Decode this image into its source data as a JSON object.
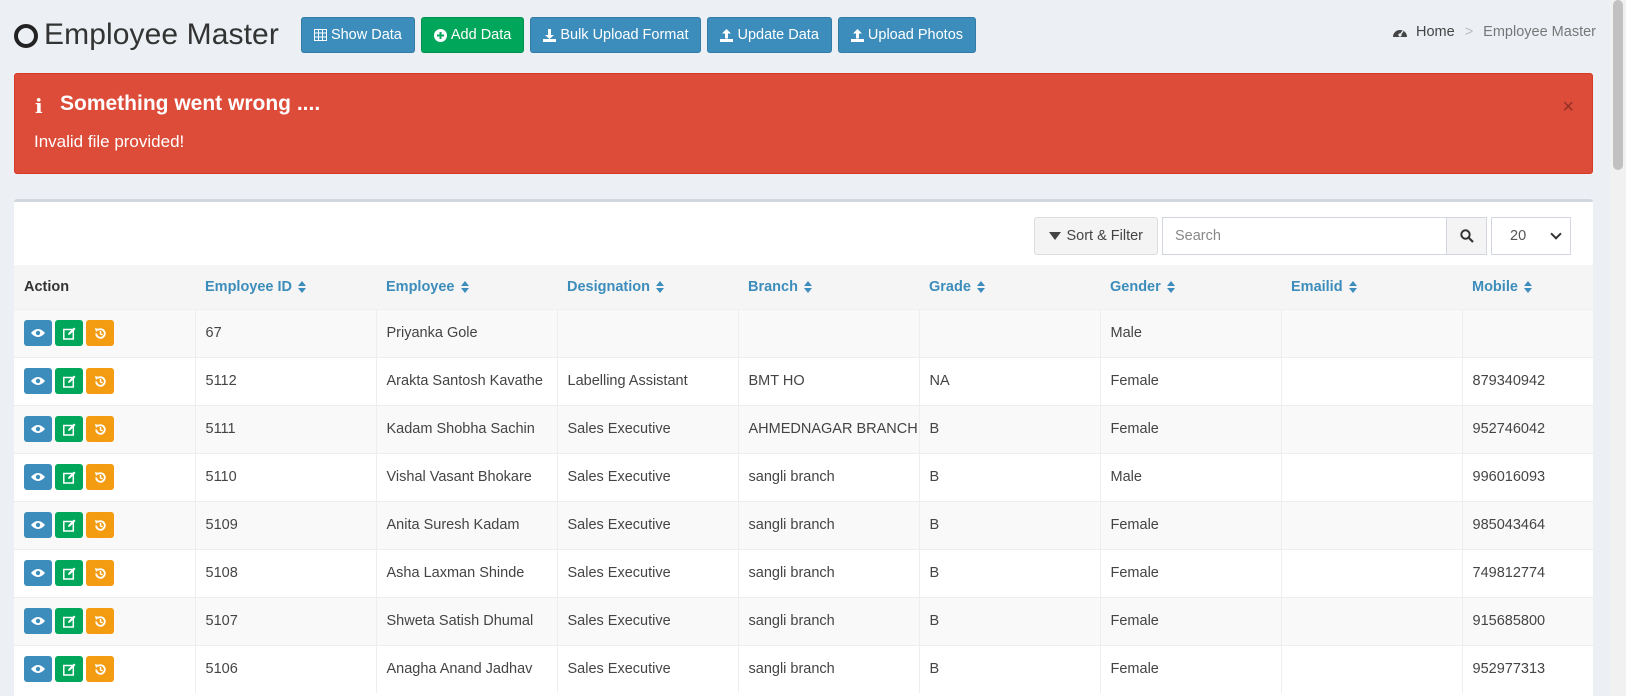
{
  "header": {
    "title": "Employee Master",
    "buttons": {
      "show_data": "Show Data",
      "add_data": "Add Data",
      "bulk_upload": "Bulk Upload Format",
      "update_data": "Update Data",
      "upload_photos": "Upload Photos"
    }
  },
  "breadcrumb": {
    "home": "Home",
    "separator": ">",
    "current": "Employee Master"
  },
  "alert": {
    "title": "Something went wrong ....",
    "message": "Invalid file provided!",
    "close": "×",
    "color": "#dd4b39"
  },
  "toolbar": {
    "sort_filter": "Sort & Filter",
    "search_placeholder": "Search",
    "page_size": "20"
  },
  "table": {
    "columns": {
      "action": "Action",
      "employee_id": "Employee ID",
      "employee": "Employee",
      "designation": "Designation",
      "branch": "Branch",
      "grade": "Grade",
      "gender": "Gender",
      "emailid": "Emailid",
      "mobile": "Mobile"
    },
    "rows": [
      {
        "id": "67",
        "name": "Priyanka Gole",
        "designation": "",
        "branch": "",
        "grade": "",
        "gender": "Male",
        "email": "",
        "mobile": ""
      },
      {
        "id": "5112",
        "name": "Arakta Santosh Kavathe",
        "designation": "Labelling Assistant",
        "branch": "BMT HO",
        "grade": "NA",
        "gender": "Female",
        "email": "",
        "mobile": "879340942"
      },
      {
        "id": "5111",
        "name": "Kadam Shobha Sachin",
        "designation": "Sales Executive",
        "branch": "AHMEDNAGAR BRANCH",
        "grade": "B",
        "gender": "Female",
        "email": "",
        "mobile": "952746042"
      },
      {
        "id": "5110",
        "name": "Vishal Vasant Bhokare",
        "designation": "Sales Executive",
        "branch": "sangli branch",
        "grade": "B",
        "gender": "Male",
        "email": "",
        "mobile": "996016093"
      },
      {
        "id": "5109",
        "name": "Anita Suresh Kadam",
        "designation": "Sales Executive",
        "branch": "sangli branch",
        "grade": "B",
        "gender": "Female",
        "email": "",
        "mobile": "985043464"
      },
      {
        "id": "5108",
        "name": "Asha Laxman Shinde",
        "designation": "Sales Executive",
        "branch": "sangli branch",
        "grade": "B",
        "gender": "Female",
        "email": "",
        "mobile": "749812774"
      },
      {
        "id": "5107",
        "name": "Shweta Satish Dhumal",
        "designation": "Sales Executive",
        "branch": "sangli branch",
        "grade": "B",
        "gender": "Female",
        "email": "",
        "mobile": "915685800"
      },
      {
        "id": "5106",
        "name": "Anagha Anand Jadhav",
        "designation": "Sales Executive",
        "branch": "sangli branch",
        "grade": "B",
        "gender": "Female",
        "email": "",
        "mobile": "952977313"
      }
    ]
  },
  "colors": {
    "primary": "#3c8dbc",
    "success": "#00a65a",
    "warning": "#f39c12",
    "danger": "#dd4b39"
  }
}
